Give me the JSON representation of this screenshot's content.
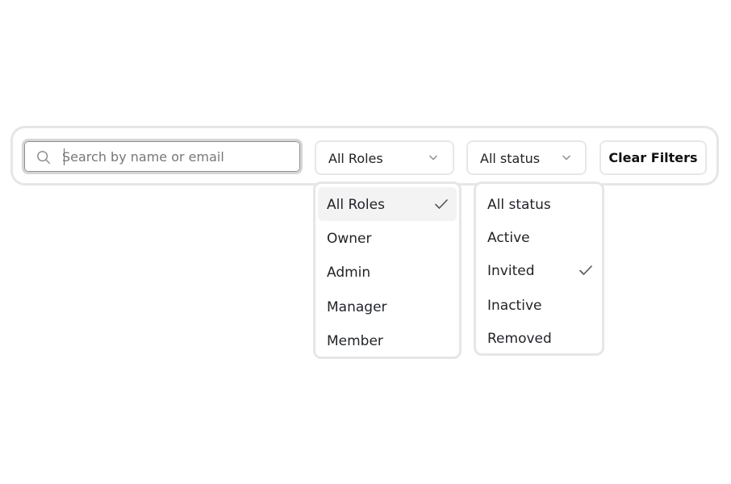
{
  "search": {
    "placeholder": "Search by name or email",
    "value": ""
  },
  "filters": {
    "roles": {
      "selected_label": "All Roles",
      "options": [
        {
          "label": "All Roles",
          "selected": true
        },
        {
          "label": "Owner",
          "selected": false
        },
        {
          "label": "Admin",
          "selected": false
        },
        {
          "label": "Manager",
          "selected": false
        },
        {
          "label": "Member",
          "selected": false
        }
      ]
    },
    "status": {
      "selected_label": "All status",
      "options": [
        {
          "label": "All status",
          "selected": false
        },
        {
          "label": "Active",
          "selected": false
        },
        {
          "label": "Invited",
          "selected": true
        },
        {
          "label": "Inactive",
          "selected": false
        },
        {
          "label": "Removed",
          "selected": false
        }
      ]
    }
  },
  "actions": {
    "clear_label": "Clear Filters"
  },
  "icons": {
    "search": "search-icon",
    "chevron": "chevron-down-icon",
    "check": "check-icon"
  },
  "colors": {
    "border": "#e6e6e6",
    "text": "#1f2328",
    "hover_bg": "#f3f3f3"
  }
}
